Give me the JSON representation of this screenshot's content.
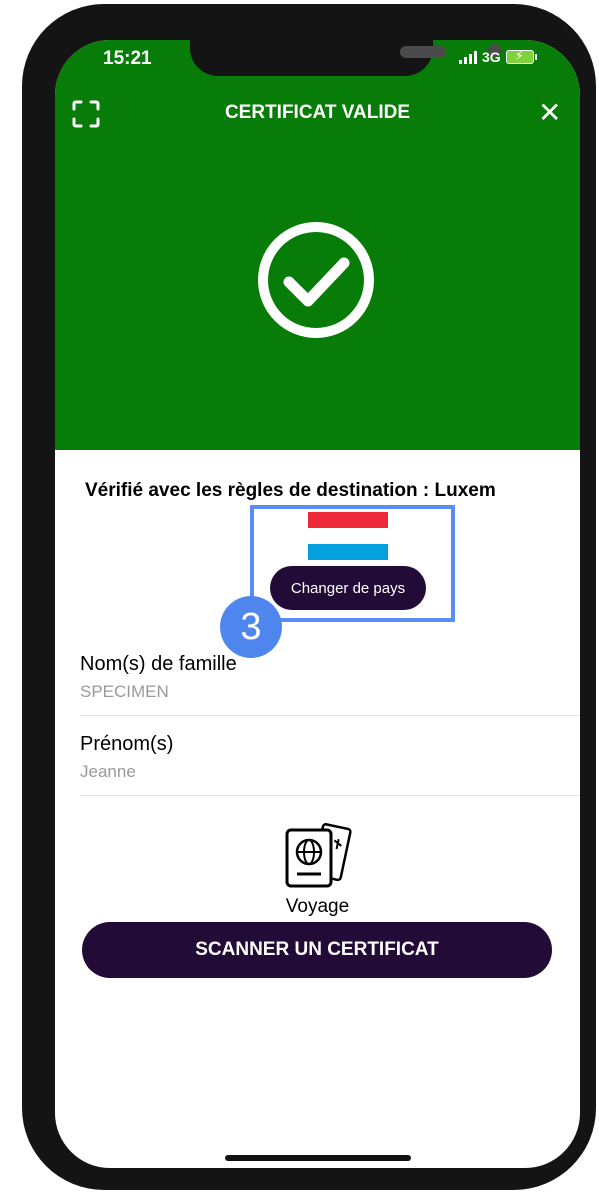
{
  "status_bar": {
    "time": "15:21",
    "network": "3G"
  },
  "header": {
    "title": "CERTIFICAT VALIDE",
    "close_glyph": "✕",
    "scan_icon": "scan-frame-icon",
    "status_icon": "check-circle-icon",
    "background_color": "#087c08"
  },
  "destination": {
    "text": "Vérifié avec les règles de destination : Luxem",
    "flag_colors": [
      "#ed2939",
      "#ffffff",
      "#00a1de"
    ],
    "change_country_label": "Changer de pays"
  },
  "fields": [
    {
      "label": "Nom(s) de famille",
      "value": "SPECIMEN"
    },
    {
      "label": "Prénom(s)",
      "value": "Jeanne"
    }
  ],
  "voyage": {
    "icon": "passport-ticket-icon",
    "label": "Voyage"
  },
  "scan_button_label": "SCANNER UN CERTIFICAT",
  "annotation": {
    "step_number": "3",
    "highlight_color": "#5b8cf4"
  },
  "colors": {
    "primary_dark": "#230b38",
    "success_green": "#087c08"
  }
}
